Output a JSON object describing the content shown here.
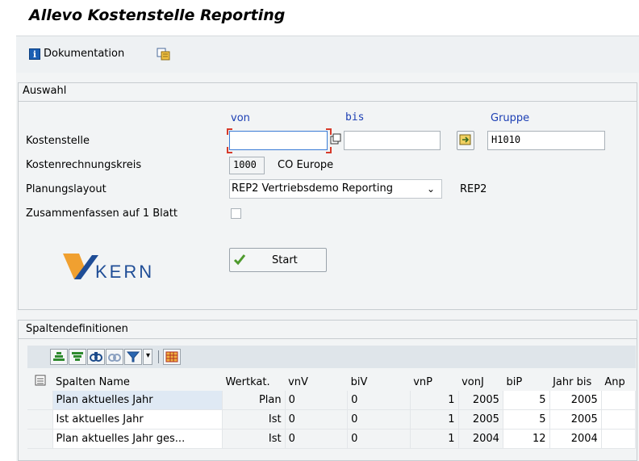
{
  "app": {
    "title": "Allevo Kostenstelle Reporting"
  },
  "toolbar": {
    "doc_label": "Dokumentation"
  },
  "auswahl": {
    "title": "Auswahl",
    "hdr_von": "von",
    "hdr_bis": "bis",
    "hdr_gruppe": "Gruppe",
    "kostenstelle_label": "Kostenstelle",
    "kostenstelle_von": "",
    "kostenstelle_bis": "",
    "gruppe_value": "H1010",
    "kostenrechnungskreis_label": "Kostenrechnungskreis",
    "kokrs_value": "1000",
    "kokrs_text": "CO Europe",
    "planungslayout_label": "Planungslayout",
    "planungslayout_value": "REP2 Vertriebsdemo Reporting",
    "planungslayout_code": "REP2",
    "zusammenfassen_label": "Zusammenfassen auf 1 Blatt",
    "start_label": "Start",
    "logo_text": "KERN"
  },
  "spalten": {
    "title": "Spaltendefinitionen",
    "columns": [
      "Spalten Name",
      "Wertkat.",
      "vnV",
      "biV",
      "vnP",
      "vonJ",
      "biP",
      "Jahr bis",
      "Anp"
    ],
    "rows": [
      {
        "name": "Plan aktuelles Jahr",
        "wertkat": "Plan",
        "vnv": "0",
        "biv": "0",
        "vnp": "1",
        "vonj": "2005",
        "bip": "5",
        "jahrbis": "2005",
        "anp": ""
      },
      {
        "name": "Ist aktuelles Jahr",
        "wertkat": "Ist",
        "vnv": "0",
        "biv": "0",
        "vnp": "1",
        "vonj": "2005",
        "bip": "5",
        "jahrbis": "2005",
        "anp": ""
      },
      {
        "name": "Plan aktuelles Jahr ges...",
        "wertkat": "Ist",
        "vnv": "0",
        "biv": "0",
        "vnp": "1",
        "vonj": "2004",
        "bip": "12",
        "jahrbis": "2004",
        "anp": ""
      }
    ]
  },
  "icons": {
    "doc": "info-icon",
    "copy": "copy-icon",
    "multi_select": "multiple-selection-icon",
    "group_nav": "group-navigation-icon",
    "check": "check-icon",
    "table_tools": [
      "sort-ascending-icon",
      "sort-descending-icon",
      "find-icon",
      "find-next-icon",
      "filter-icon",
      "dropdown-icon",
      "layout-icon"
    ],
    "row_selector": "select-all-icon"
  },
  "colors": {
    "accent_blue": "#1c3fb4",
    "logo_orange": "#f0a030",
    "logo_blue": "#1f4d96",
    "focus_red": "#d63a2a",
    "check_green": "#4e9a2d"
  }
}
